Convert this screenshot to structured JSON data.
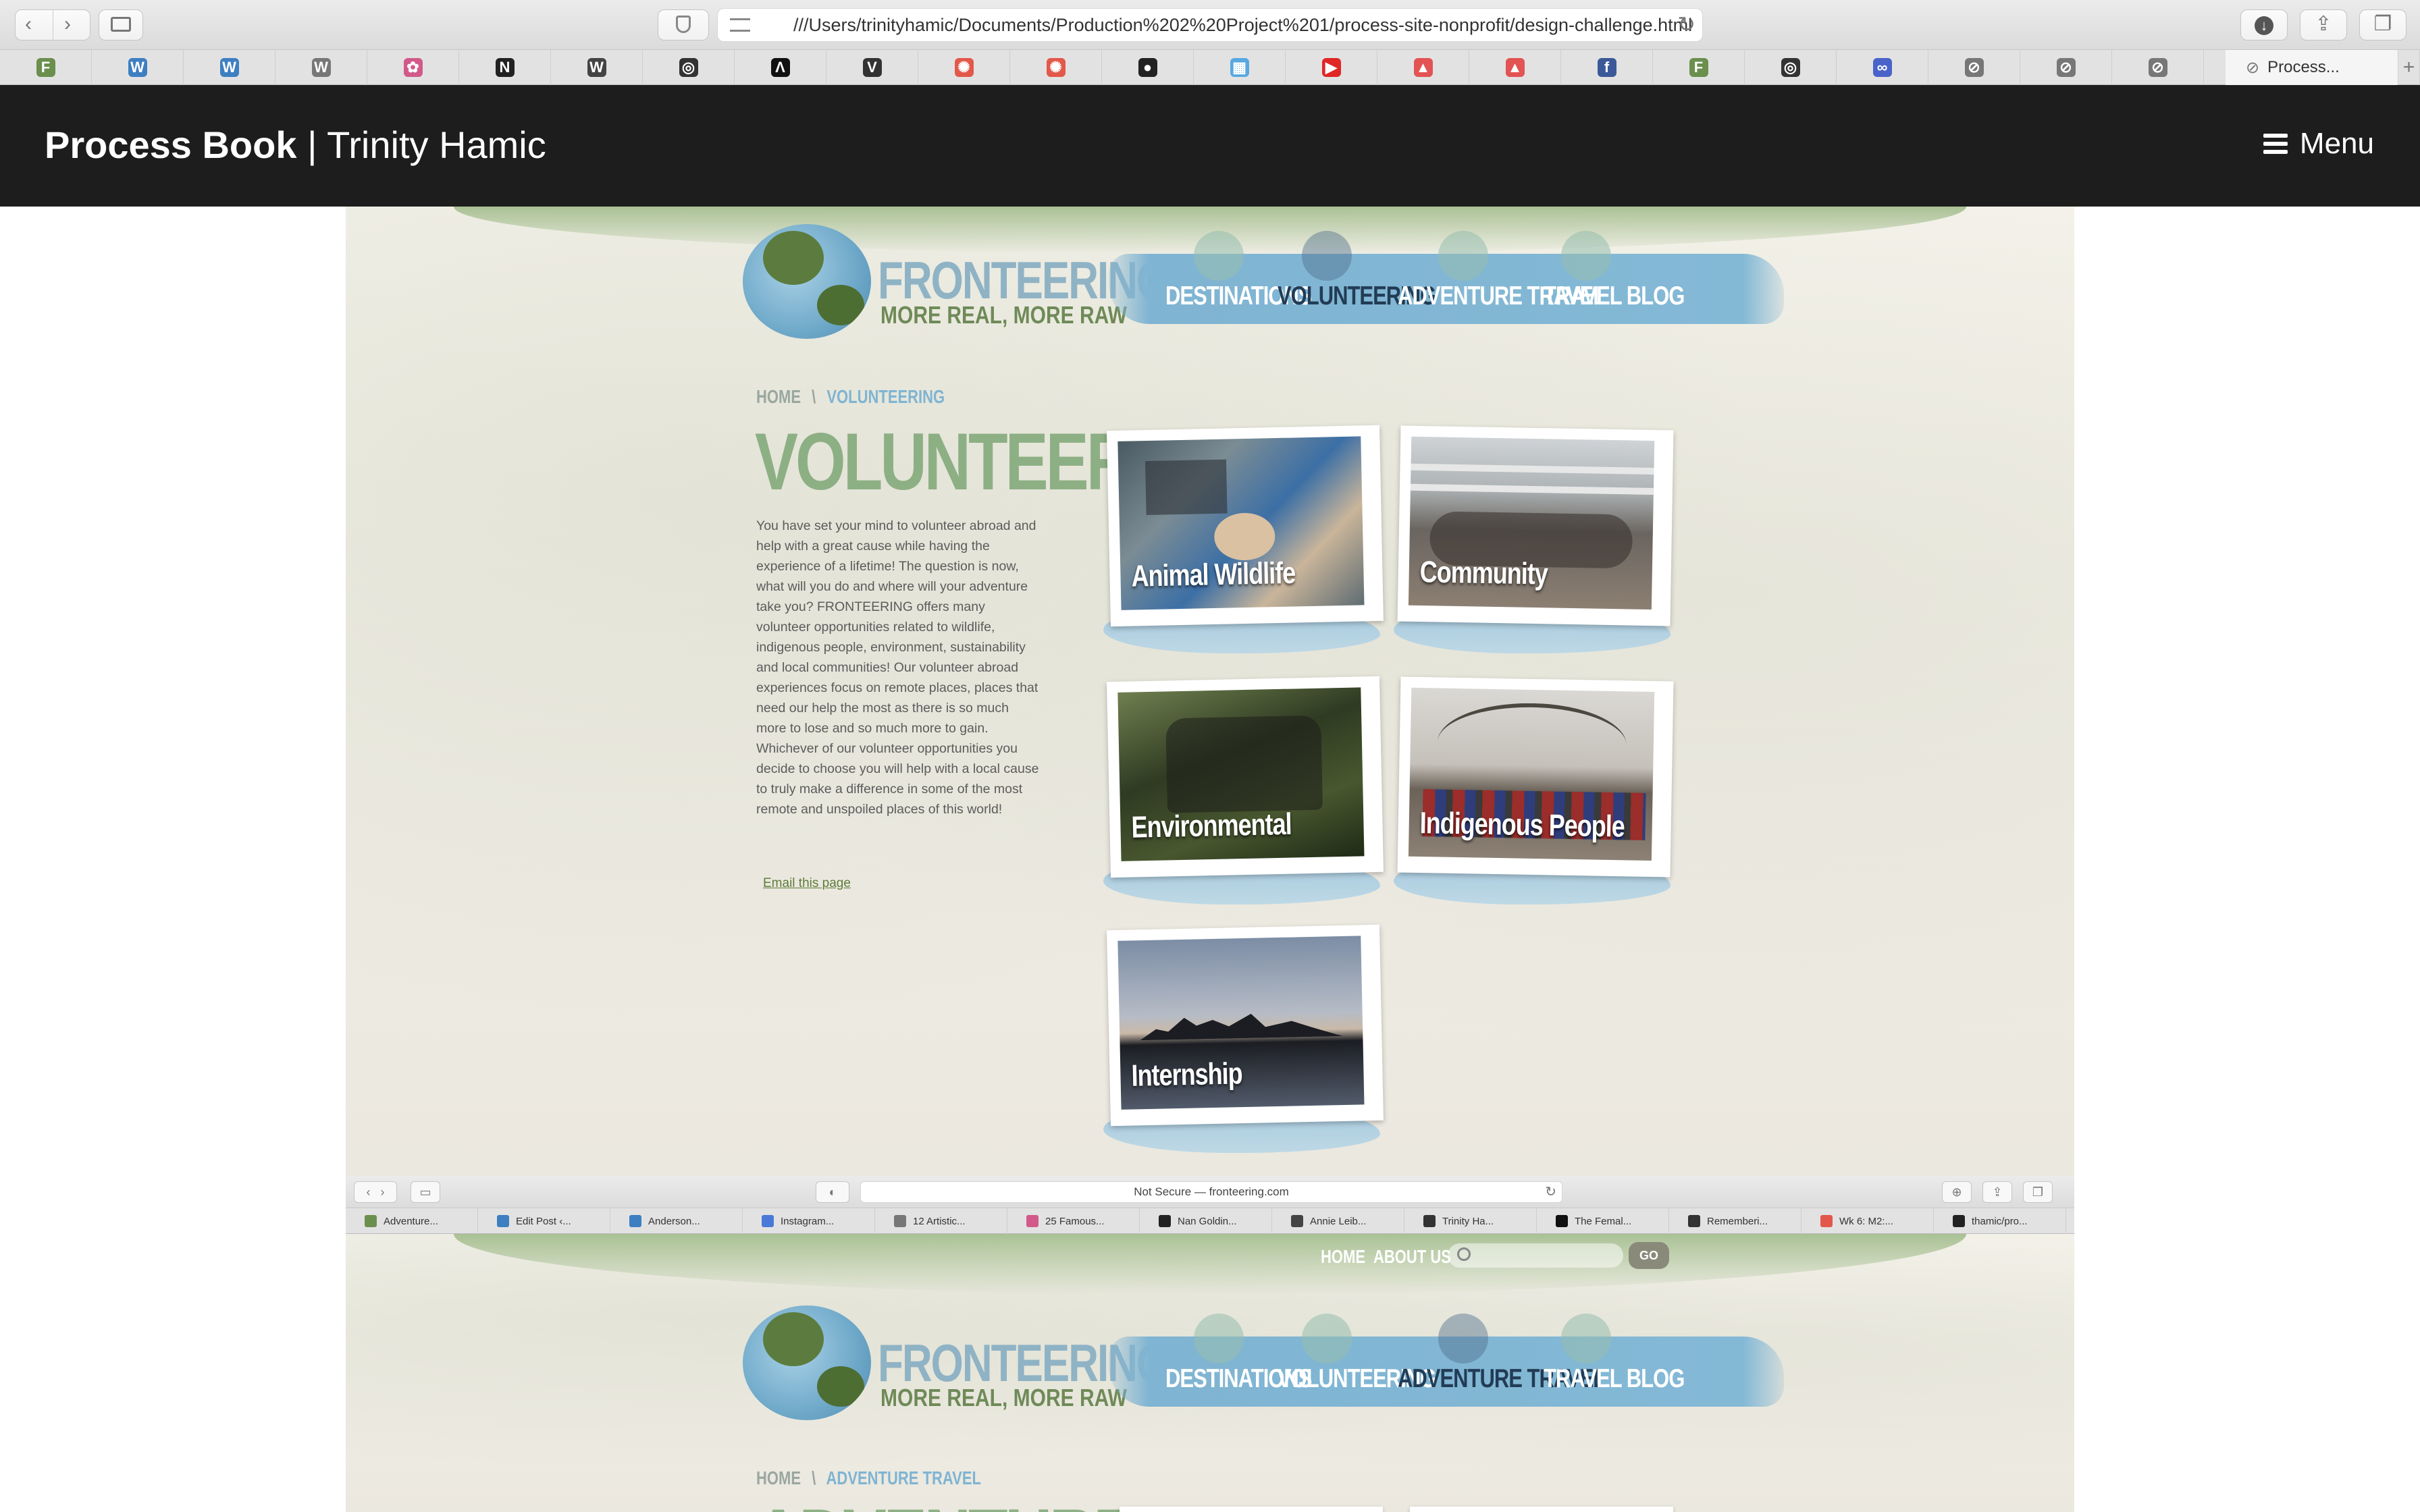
{
  "browser": {
    "url": "///Users/trinityhamic/Documents/Production%202%20Project%201/process-site-nonprofit/design-challenge.html",
    "favorites": [
      {
        "icon": "F",
        "color": "#6b8f4d"
      },
      {
        "icon": "W",
        "color": "#3d7fc1"
      },
      {
        "icon": "W",
        "color": "#3d7fc1"
      },
      {
        "icon": "W",
        "color": "#777777"
      },
      {
        "icon": "✿",
        "color": "#d15a8a"
      },
      {
        "icon": "N",
        "color": "#222222"
      },
      {
        "icon": "W",
        "color": "#444444"
      },
      {
        "icon": "◎",
        "color": "#333333"
      },
      {
        "icon": "Λ",
        "color": "#111111"
      },
      {
        "icon": "V",
        "color": "#333333"
      },
      {
        "icon": "✺",
        "color": "#e2584a"
      },
      {
        "icon": "✺",
        "color": "#e2584a"
      },
      {
        "icon": "●",
        "color": "#222222"
      },
      {
        "icon": "▦",
        "color": "#58a9e0"
      },
      {
        "icon": "▶",
        "color": "#e02626"
      },
      {
        "icon": "▲",
        "color": "#e35353"
      },
      {
        "icon": "▲",
        "color": "#e35353"
      },
      {
        "icon": "f",
        "color": "#3b5998"
      },
      {
        "icon": "F",
        "color": "#6b8f4d"
      },
      {
        "icon": "◎",
        "color": "#333333"
      },
      {
        "icon": "∞",
        "color": "#4a63c9"
      },
      {
        "icon": "⊘",
        "color": "#777777"
      },
      {
        "icon": "⊘",
        "color": "#777777"
      },
      {
        "icon": "⊘",
        "color": "#777777"
      }
    ],
    "active_tab": "Process..."
  },
  "header": {
    "title_bold": "Process Book",
    "title_rest": " | Trinity Hamic",
    "menu_label": "Menu"
  },
  "shot1": {
    "logo_name": "FRONTEERING",
    "logo_tagline": "MORE REAL, MORE RAW",
    "nav": [
      "DESTINATIONS",
      "VOLUNTEERING",
      "ADVENTURE TRAVEL",
      "TRAVEL BLOG"
    ],
    "breadcrumb_home": "HOME",
    "breadcrumb_sep": "\\",
    "breadcrumb_current": "VOLUNTEERING",
    "page_title": "VOLUNTEERING",
    "body": "You have set your mind to volunteer abroad and help with a great cause while having the experience of a lifetime! The question is now, what will you do and where will your adventure take you? FRONTEERING offers many volunteer opportunities related to wildlife, indigenous people, environment, sustainability and local communities! Our volunteer abroad experiences focus on remote places, places that need our help the most as there is so much more to lose and so much more to gain. Whichever of our volunteer opportunities you decide to choose you will help with a local cause to truly make a difference in some of the most remote and unspoiled places of this world!",
    "email_link": "Email this page",
    "cards": [
      "Animal Wildlife",
      "Community",
      "Environmental",
      "Indigenous People",
      "Internship"
    ]
  },
  "mini_browser": {
    "url": "Not Secure — fronteering.com",
    "tabs": [
      "Adventure...",
      "Edit Post ‹...",
      "Anderson...",
      "Instagram...",
      "12 Artistic...",
      "25 Famous...",
      "Nan Goldin...",
      "Annie Leib...",
      "Trinity Ha...",
      "The Femal...",
      "Rememberi...",
      "Wk 6: M2:...",
      "thamic/pro..."
    ]
  },
  "shot2": {
    "top_nav": [
      "HOME",
      "ABOUT US"
    ],
    "go_label": "GO",
    "logo_name": "FRONTEERING",
    "logo_tagline": "MORE REAL, MORE RAW",
    "nav": [
      "DESTINATIONS",
      "VOLUNTEERING",
      "ADVENTURE TRAVEL",
      "TRAVEL BLOG"
    ],
    "breadcrumb_home": "HOME",
    "breadcrumb_sep": "\\",
    "breadcrumb_current": "ADVENTURE TRAVEL",
    "page_title_partial": "ADVENTURE"
  }
}
